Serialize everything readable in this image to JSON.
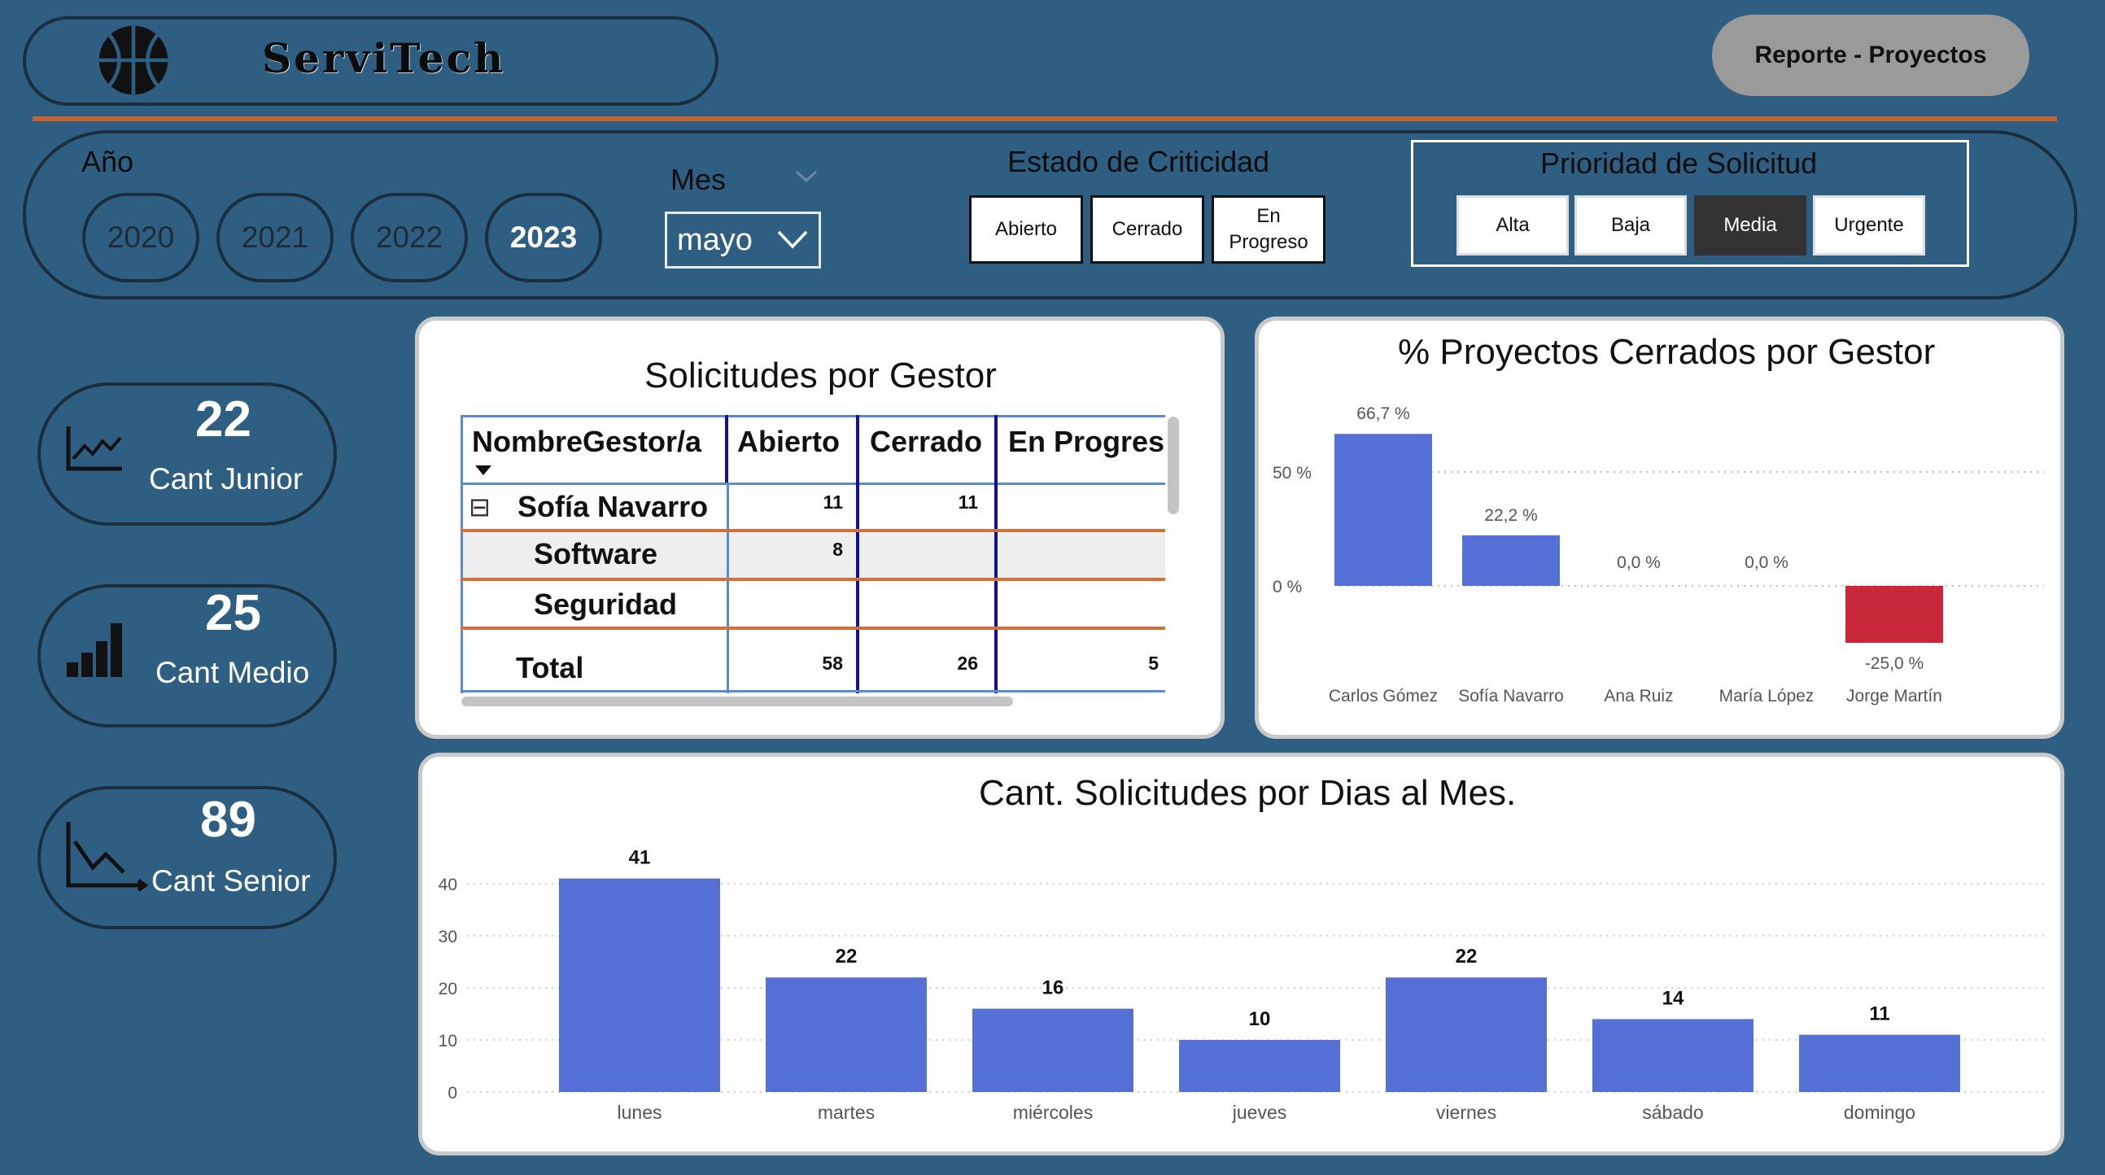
{
  "brand": {
    "name": "ServiTech",
    "logo_icon": "basketball-icon"
  },
  "header": {
    "report_button": "Reporte - Proyectos",
    "accent": "#c8612e"
  },
  "filters": {
    "year_label": "Año",
    "years": [
      "2020",
      "2021",
      "2022",
      "2023"
    ],
    "selected_year": "2023",
    "month_label": "Mes",
    "month_value": "mayo",
    "criticidad_label": "Estado de Criticidad",
    "criticidad": [
      "Abierto",
      "Cerrado",
      "En Progreso"
    ],
    "prioridad_label": "Prioridad de Solicitud",
    "prioridad": [
      "Alta",
      "Baja",
      "Media",
      "Urgente"
    ],
    "prioridad_selected": "Media"
  },
  "kpis": [
    {
      "value": "22",
      "label": "Cant Junior",
      "icon": "line-trend-icon"
    },
    {
      "value": "25",
      "label": "Cant Medio",
      "icon": "bar-signal-icon"
    },
    {
      "value": "89",
      "label": "Cant Senior",
      "icon": "decline-chart-icon"
    }
  ],
  "matrix": {
    "title": "Solicitudes por Gestor",
    "headers": [
      "NombreGestor/a",
      "Abierto",
      "Cerrado",
      "En Progreso"
    ],
    "rows": [
      {
        "label": "Sofía Navarro",
        "expander": "⊟",
        "abierto": "11",
        "cerrado": "11",
        "en_progreso": ""
      },
      {
        "label": "Software",
        "abierto": "8",
        "cerrado": "",
        "en_progreso": ""
      },
      {
        "label": "Seguridad",
        "abierto": "",
        "cerrado": "",
        "en_progreso": ""
      }
    ],
    "total": {
      "label": "Total",
      "abierto": "58",
      "cerrado": "26",
      "en_progreso": "5"
    }
  },
  "chart_data": [
    {
      "type": "bar",
      "title": "% Proyectos Cerrados por Gestor",
      "categories": [
        "Carlos Gómez",
        "Sofía Navarro",
        "Ana Ruiz",
        "María López",
        "Jorge Martín"
      ],
      "values": [
        66.7,
        22.2,
        0.0,
        0.0,
        -25.0
      ],
      "data_labels": [
        "66,7 %",
        "22,2 %",
        "0,0 %",
        "0,0 %",
        "-25,0 %"
      ],
      "yticks": [
        "0 %",
        "50 %"
      ],
      "ylim": [
        -35,
        80
      ],
      "colors": {
        "positive": "#5470d6",
        "negative": "#c8283a"
      },
      "grid": true
    },
    {
      "type": "bar",
      "title": "Cant. Solicitudes por Dias al Mes.",
      "categories": [
        "lunes",
        "martes",
        "miércoles",
        "jueves",
        "viernes",
        "sábado",
        "domingo"
      ],
      "values": [
        41,
        22,
        16,
        10,
        22,
        14,
        11
      ],
      "yticks": [
        "0",
        "10",
        "20",
        "30",
        "40"
      ],
      "ylim": [
        0,
        40
      ],
      "color": "#5470d6",
      "grid": true
    }
  ]
}
